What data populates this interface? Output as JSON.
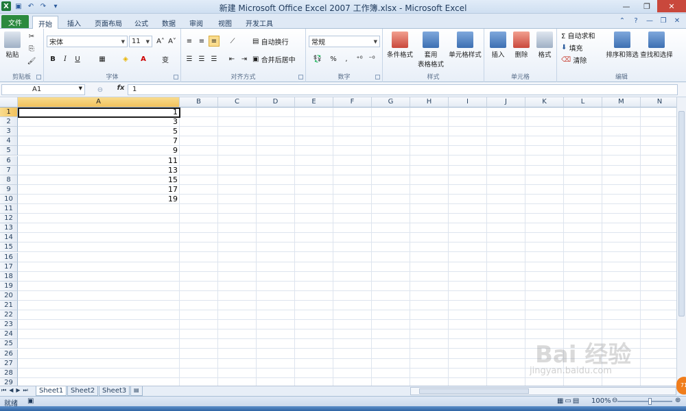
{
  "window": {
    "title": "新建 Microsoft Office Excel 2007 工作簿.xlsx - Microsoft Excel",
    "controls": [
      "—",
      "❐",
      "✕"
    ]
  },
  "qat": {
    "undo": "↶",
    "redo": "↷",
    "save": "💾",
    "customize": "▾",
    "app": "X"
  },
  "tabs": [
    "文件",
    "开始",
    "插入",
    "页面布局",
    "公式",
    "数据",
    "审阅",
    "视图",
    "开发工具"
  ],
  "ribbon": {
    "clipboard": {
      "label": "剪贴板",
      "paste": "粘贴"
    },
    "font": {
      "label": "字体",
      "font_name": "宋体",
      "font_size": "11",
      "bold": "B",
      "italic": "I",
      "underline": "U",
      "grow": "A˄",
      "shrink": "A˅",
      "wen": "变"
    },
    "alignment": {
      "label": "对齐方式",
      "wrap": "自动换行",
      "merge": "合并后居中"
    },
    "number": {
      "label": "数字",
      "format": "常规",
      "percent": "%",
      "comma": ","
    },
    "styles": {
      "label": "样式",
      "conditional": "条件格式",
      "table": "套用\n表格格式",
      "cell": "单元格样式"
    },
    "cells": {
      "label": "单元格",
      "insert": "插入",
      "delete": "删除",
      "format": "格式"
    },
    "editing": {
      "label": "编辑",
      "autosum": "Σ 自动求和",
      "fill": "填充",
      "clear": "清除",
      "sort": "排序和筛选",
      "find": "查找和选择"
    }
  },
  "formula_bar": {
    "name_box": "A1",
    "fx": "fx",
    "content": "1"
  },
  "columns": [
    "A",
    "B",
    "C",
    "D",
    "E",
    "F",
    "G",
    "H",
    "I",
    "J",
    "K",
    "L",
    "M",
    "N"
  ],
  "rows": [
    "1",
    "2",
    "3",
    "4",
    "5",
    "6",
    "7",
    "8",
    "9",
    "10",
    "11",
    "12",
    "13",
    "14",
    "15",
    "16",
    "17",
    "18",
    "19",
    "20",
    "21",
    "22",
    "23",
    "24",
    "25",
    "26",
    "27",
    "28",
    "29"
  ],
  "cells_a": [
    "1",
    "3",
    "5",
    "7",
    "9",
    "11",
    "13",
    "15",
    "17",
    "19"
  ],
  "sheets": [
    "Sheet1",
    "Sheet2",
    "Sheet3"
  ],
  "status": {
    "ready": "就绪",
    "zoom": "100%"
  },
  "watermark": {
    "main": "Bai  经验",
    "sub": "jingyan.baidu.com"
  }
}
